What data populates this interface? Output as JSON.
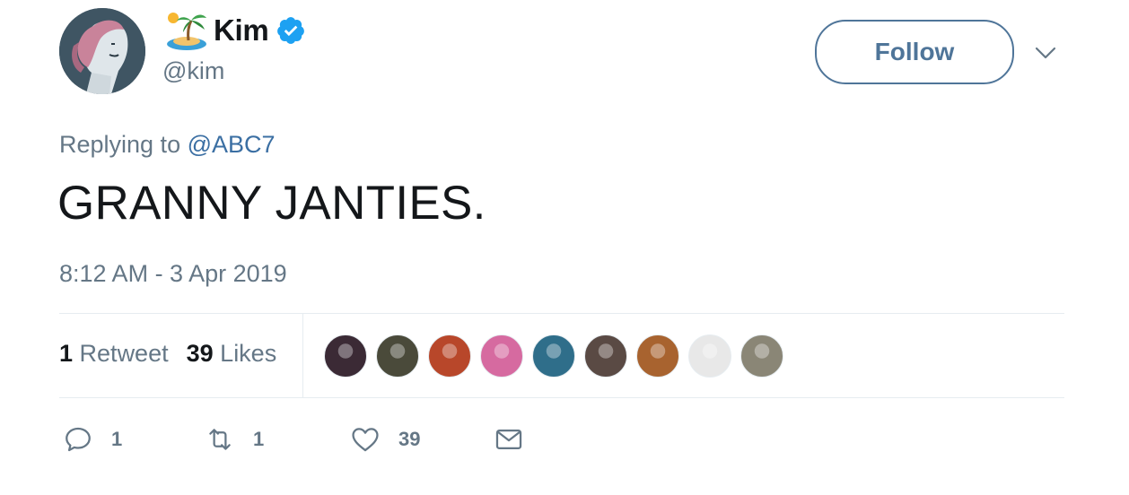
{
  "author": {
    "display_name": "Kim",
    "handle": "@kim",
    "verified": true,
    "name_emoji": "desert-island-emoji"
  },
  "follow_button": {
    "label": "Follow",
    "color": "#4f7599"
  },
  "reply": {
    "prefix": "Replying to ",
    "target": "@ABC7"
  },
  "tweet": {
    "text": "GRANNY JANTIES.",
    "timestamp": "8:12 AM - 3 Apr 2019"
  },
  "stats": {
    "retweets_count": "1",
    "retweets_label": "Retweet",
    "likes_count": "39",
    "likes_label": "Likes"
  },
  "likers": [
    {
      "name": "liker-avatar-1",
      "color": "#3b2a35"
    },
    {
      "name": "liker-avatar-2",
      "color": "#4a4a3a"
    },
    {
      "name": "liker-avatar-3",
      "color": "#b8472a"
    },
    {
      "name": "liker-avatar-4",
      "color": "#d66aa0"
    },
    {
      "name": "liker-avatar-5",
      "color": "#2f6e8a"
    },
    {
      "name": "liker-avatar-6",
      "color": "#5a4a44"
    },
    {
      "name": "liker-avatar-7",
      "color": "#a8632f"
    },
    {
      "name": "liker-avatar-8",
      "color": "#e8e8e8"
    },
    {
      "name": "liker-avatar-9",
      "color": "#8a8676"
    }
  ],
  "actions": {
    "reply_count": "1",
    "retweet_count": "1",
    "like_count": "39"
  },
  "colors": {
    "text_primary": "#14171a",
    "text_secondary": "#657786",
    "link": "#3b6fa3",
    "verified_badge": "#1da1f2",
    "divider": "#e6ecf0"
  }
}
